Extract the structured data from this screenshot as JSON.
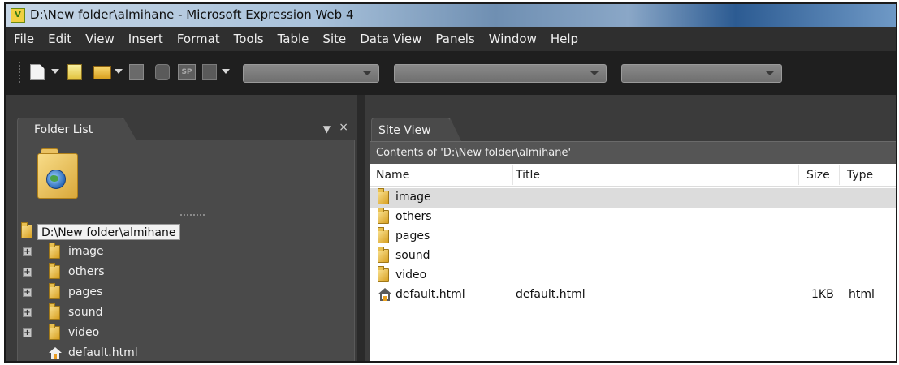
{
  "window": {
    "title": "D:\\New folder\\almihane - Microsoft Expression Web 4",
    "app_icon_letter": "V"
  },
  "menu": [
    "File",
    "Edit",
    "View",
    "Insert",
    "Format",
    "Tools",
    "Table",
    "Site",
    "Data View",
    "Panels",
    "Window",
    "Help"
  ],
  "toolbar": {
    "icons": [
      "new-page-icon",
      "open-site-icon",
      "open-folder-icon",
      "save-icon",
      "publish-icon",
      "sharepoint-icon",
      "preview-icon"
    ],
    "sp_label": "SP",
    "combos": [
      {
        "name": "style-combo",
        "value": ""
      },
      {
        "name": "font-combo",
        "value": ""
      },
      {
        "name": "size-combo",
        "value": ""
      }
    ]
  },
  "folder_panel": {
    "tab_label": "Folder List",
    "pin_glyph": "📌",
    "close_glyph": "×",
    "root_label": "D:\\New folder\\almihane",
    "folders": [
      "image",
      "others",
      "pages",
      "sound",
      "video"
    ],
    "file": "default.html"
  },
  "site_view": {
    "tab_label": "Site View",
    "contents_label": "Contents of 'D:\\New folder\\almihane'",
    "columns": {
      "name": "Name",
      "title": "Title",
      "size": "Size",
      "type": "Type"
    },
    "rows": [
      {
        "name": "image",
        "title": "",
        "size": "",
        "type": "",
        "kind": "folder"
      },
      {
        "name": "others",
        "title": "",
        "size": "",
        "type": "",
        "kind": "folder"
      },
      {
        "name": "pages",
        "title": "",
        "size": "",
        "type": "",
        "kind": "folder"
      },
      {
        "name": "sound",
        "title": "",
        "size": "",
        "type": "",
        "kind": "folder"
      },
      {
        "name": "video",
        "title": "",
        "size": "",
        "type": "",
        "kind": "folder"
      },
      {
        "name": "default.html",
        "title": "default.html",
        "size": "1KB",
        "type": "html",
        "kind": "home-page"
      }
    ]
  }
}
